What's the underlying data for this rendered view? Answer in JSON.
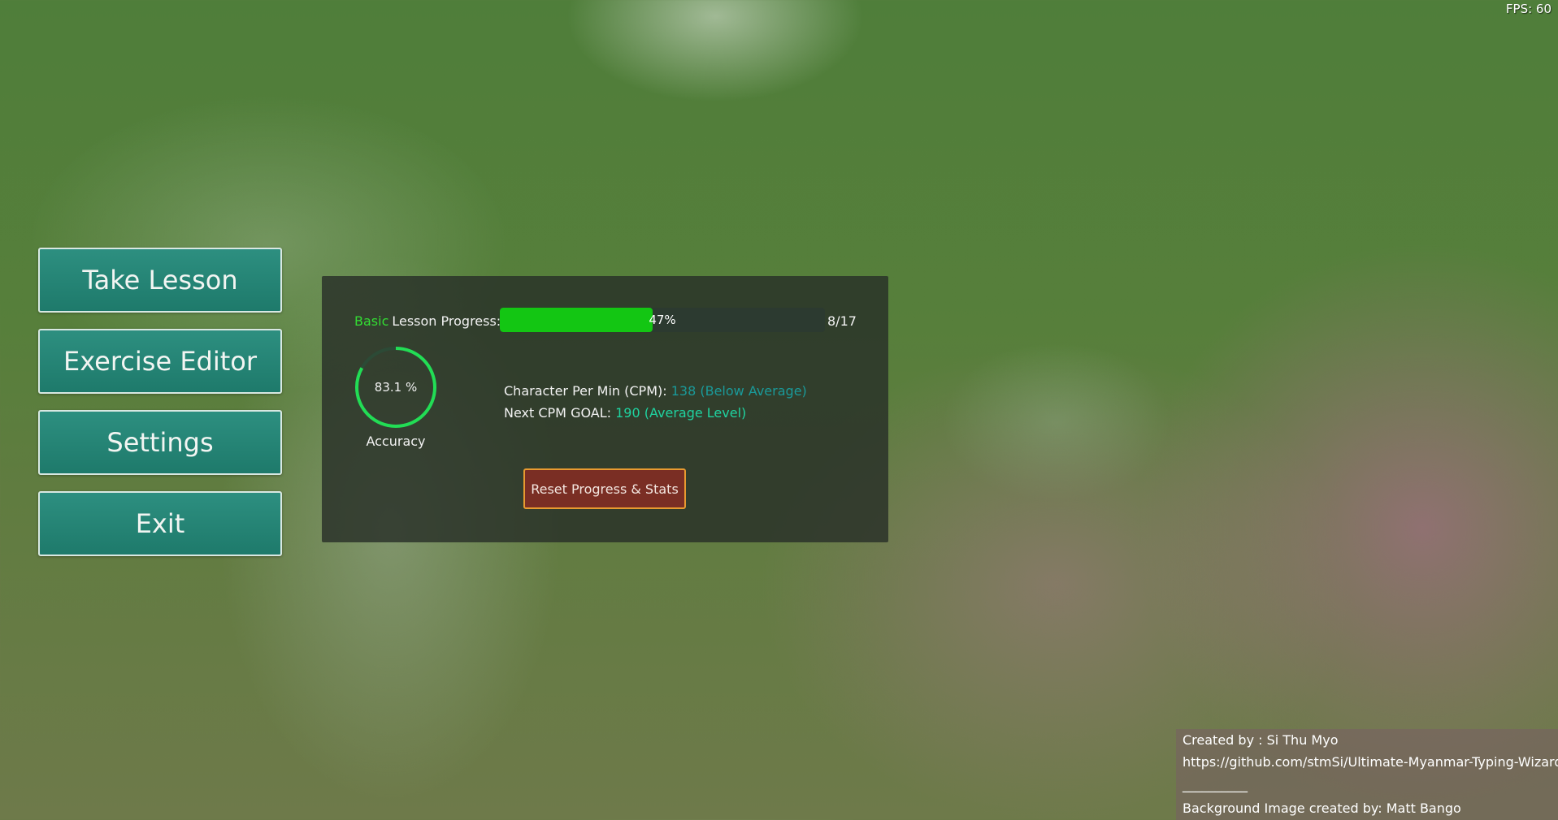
{
  "fps_text": "FPS: 60",
  "menu": {
    "take_lesson": "Take Lesson",
    "exercise_editor": "Exercise Editor",
    "settings": "Settings",
    "exit": "Exit"
  },
  "panel": {
    "level": "Basic",
    "progress_label": "Lesson Progress:",
    "progress_percent_text": "47%",
    "progress_fraction": 0.47,
    "progress_count": "8/17",
    "accuracy_text": "83.1 %",
    "accuracy_fraction": 0.831,
    "accuracy_label": "Accuracy",
    "cpm_label": "Character Per Min (CPM):",
    "cpm_value": "138 (Below Average)",
    "goal_label": "Next CPM GOAL:",
    "goal_value": "190 (Average Level)",
    "reset_button": "Reset Progress & Stats"
  },
  "credits": {
    "created_by": "Created by : Si Thu Myo",
    "url": "https://github.com/stmSi/Ultimate-Myanmar-Typing-Wizard",
    "separator": "__________",
    "background_credit": "Background Image created by: Matt Bango"
  },
  "colors": {
    "menu_button": "#1e7a6b",
    "progress_fill": "#13c613",
    "accuracy_ring": "#22dd55",
    "reset_border": "#e89a30"
  }
}
